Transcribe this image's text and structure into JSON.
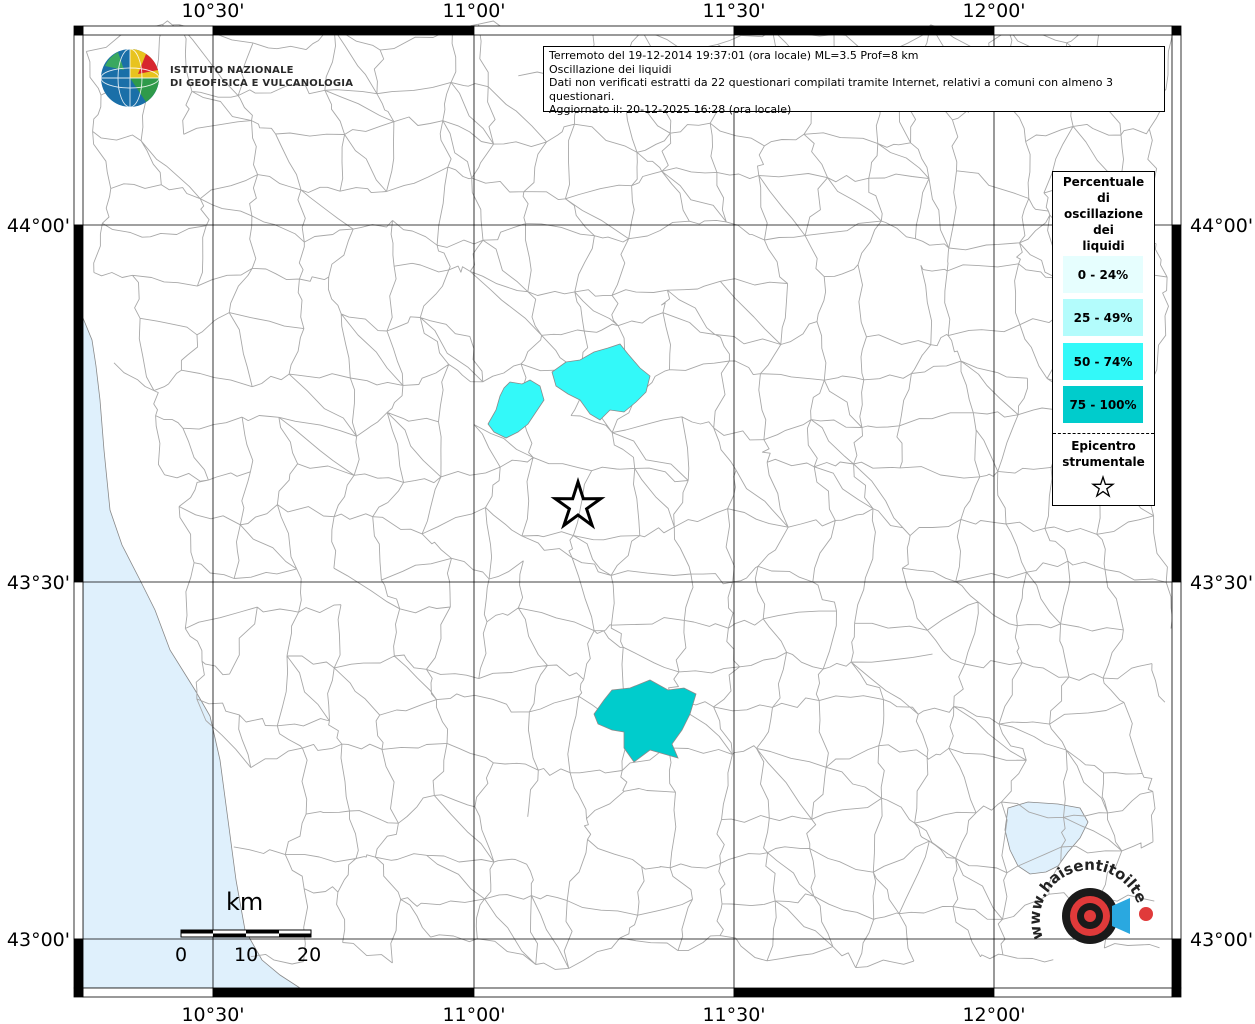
{
  "map": {
    "lon_labels": [
      "10°30'",
      "11°00'",
      "11°30'",
      "12°00'"
    ],
    "lat_labels": [
      "44°00'",
      "43°30'",
      "43°00'"
    ]
  },
  "logo_ingv": {
    "line1": "ISTITUTO NAZIONALE",
    "line2": "DI GEOFISICA E VULCANOLOGIA"
  },
  "info": {
    "line1": "Terremoto del 19-12-2014 19:37:01 (ora locale) ML=3.5 Prof=8 km",
    "line2": "Oscillazione dei liquidi",
    "line3": "Dati non verificati estratti da 22 questionari compilati tramite Internet, relativi a comuni con almeno 3 questionari.",
    "line4": "Aggiornato il: 20-12-2025 16:28 (ora locale)"
  },
  "legend": {
    "title_lines": [
      "Percentuale",
      "di",
      "oscillazione",
      "dei",
      "liquidi"
    ],
    "classes": [
      {
        "label": "0 - 24%",
        "color": "#e6fefe"
      },
      {
        "label": "25 - 49%",
        "color": "#b3fcfc"
      },
      {
        "label": "50 - 74%",
        "color": "#33f9f9"
      },
      {
        "label": "75 - 100%",
        "color": "#00cccc"
      }
    ],
    "epicenter_lines": [
      "Epicentro",
      "strumentale"
    ]
  },
  "scale": {
    "unit": "km",
    "labels": [
      "0",
      "10",
      "20"
    ]
  },
  "logo_hsit": {
    "ring_text": "www.haisentitoilterremoto.it"
  },
  "colors": {
    "sea": "#dff0fc",
    "border_lines": "#a8a8a8",
    "grid": "#000000",
    "class_50_74": "#33f9f9",
    "class_75_100": "#00cccc"
  }
}
